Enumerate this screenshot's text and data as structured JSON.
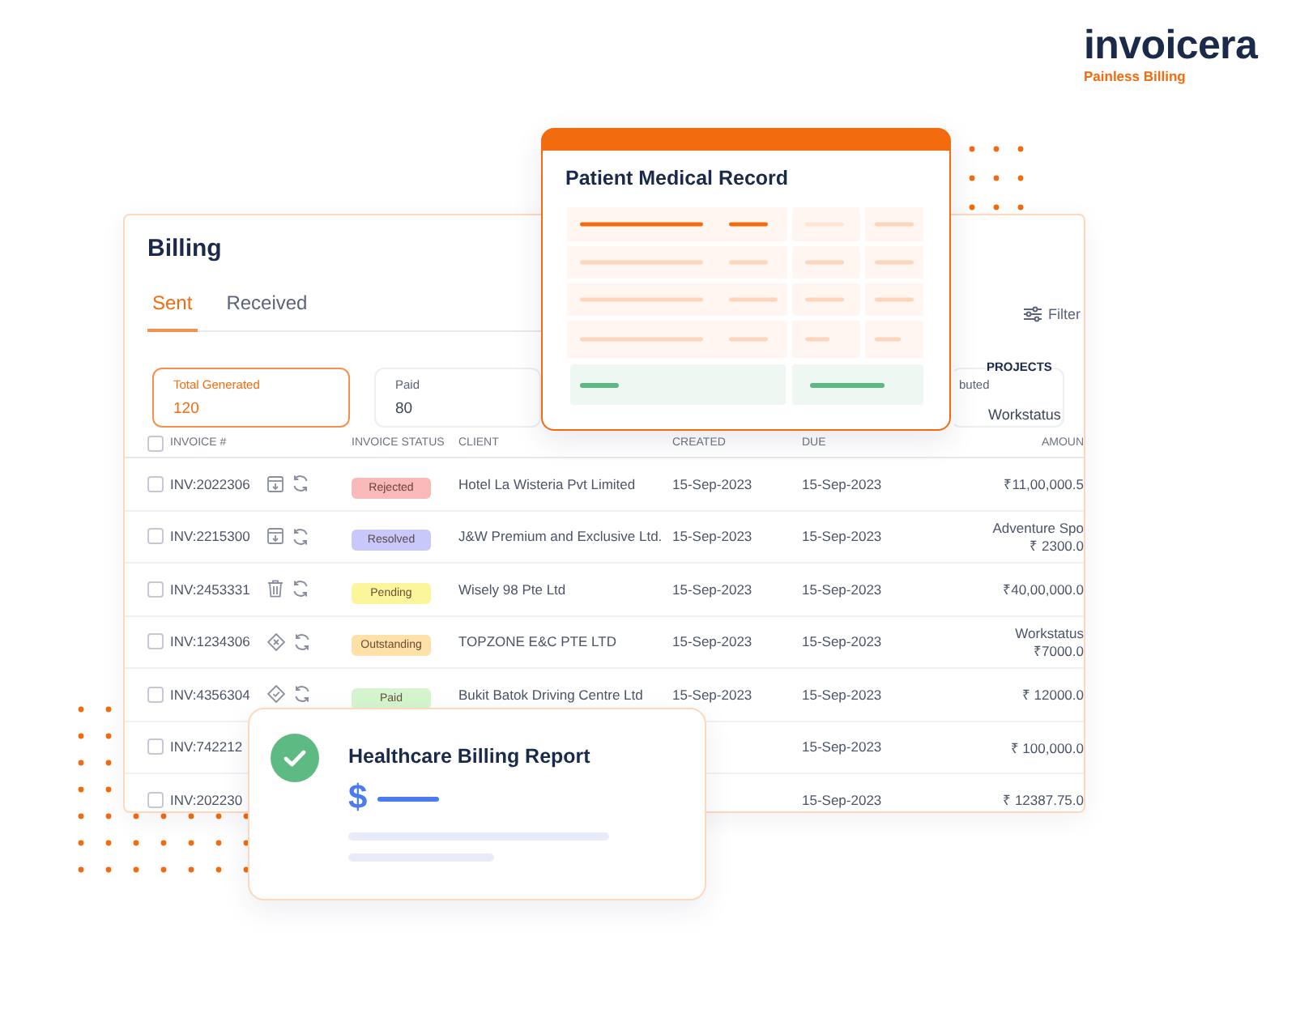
{
  "logo": {
    "name": "invoicera",
    "tagline": "Painless Billing"
  },
  "billing": {
    "title": "Billing",
    "tabs": [
      {
        "label": "Sent",
        "selected": true
      },
      {
        "label": "Received",
        "selected": false
      }
    ],
    "filter": "Filter",
    "projects_label": "PROJECTS",
    "projects_value": "Workstatus",
    "stats": [
      {
        "label": "Total Generated",
        "value": "120",
        "selected": true
      },
      {
        "label": "Paid",
        "value": "80",
        "selected": false
      },
      {
        "label": "buted",
        "selected": false
      }
    ],
    "select_all": {
      "checked": false
    },
    "columns": [
      "INVOICE #",
      "INVOICE STATUS",
      "CLIENT",
      "CREATED",
      "DUE",
      "AMOUN"
    ],
    "rows": [
      {
        "checked": false,
        "invoice": "INV:2022306",
        "kind": "archive",
        "status": {
          "label": "Rejected",
          "color": "#f9b9b9"
        },
        "client": "Hotel La Wisteria Pvt Limited",
        "created": "15-Sep-2023",
        "due": "15-Sep-2023",
        "amount": "₹11,00,000.5"
      },
      {
        "checked": false,
        "invoice": "INV:2215300",
        "kind": "archive",
        "status": {
          "label": "Resolved",
          "color": "#c8c8fb"
        },
        "client": "J&W Premium and Exclusive Ltd.",
        "created": "15-Sep-2023",
        "due": "15-Sep-2023",
        "note": "Adventure Spo",
        "amount": "₹ 2300.0"
      },
      {
        "checked": false,
        "invoice": "INV:2453331",
        "kind": "trash",
        "status": {
          "label": "Pending",
          "color": "#fbf59b"
        },
        "client": "Wisely 98 Pte Ltd",
        "created": "15-Sep-2023",
        "due": "15-Sep-2023",
        "amount": "₹40,00,000.0"
      },
      {
        "checked": false,
        "invoice": "INV:1234306",
        "kind": "diamond_x",
        "status": {
          "label": "Outstanding",
          "color": "#fde1a8"
        },
        "client": "TOPZONE E&C PTE LTD",
        "created": "15-Sep-2023",
        "due": "15-Sep-2023",
        "note": "Workstatus",
        "amount": "₹7000.0"
      },
      {
        "checked": false,
        "invoice": "INV:4356304",
        "kind": "diamond_check",
        "status": {
          "label": "Paid",
          "color": "#d5f5cf"
        },
        "client": "Bukit Batok Driving Centre Ltd",
        "created": "15-Sep-2023",
        "due": "15-Sep-2023",
        "amount": "₹ 12000.0"
      },
      {
        "checked": false,
        "invoice": "INV:742212",
        "due": "15-Sep-2023",
        "amount": "₹ 100,000.0"
      },
      {
        "checked": false,
        "invoice": "INV:202230",
        "due": "15-Sep-2023",
        "amount": "₹ 12387.75.0"
      }
    ]
  },
  "record_card": {
    "title": "Patient Medical Record"
  },
  "report_card": {
    "title": "Healthcare Billing Report",
    "currency": "$"
  }
}
